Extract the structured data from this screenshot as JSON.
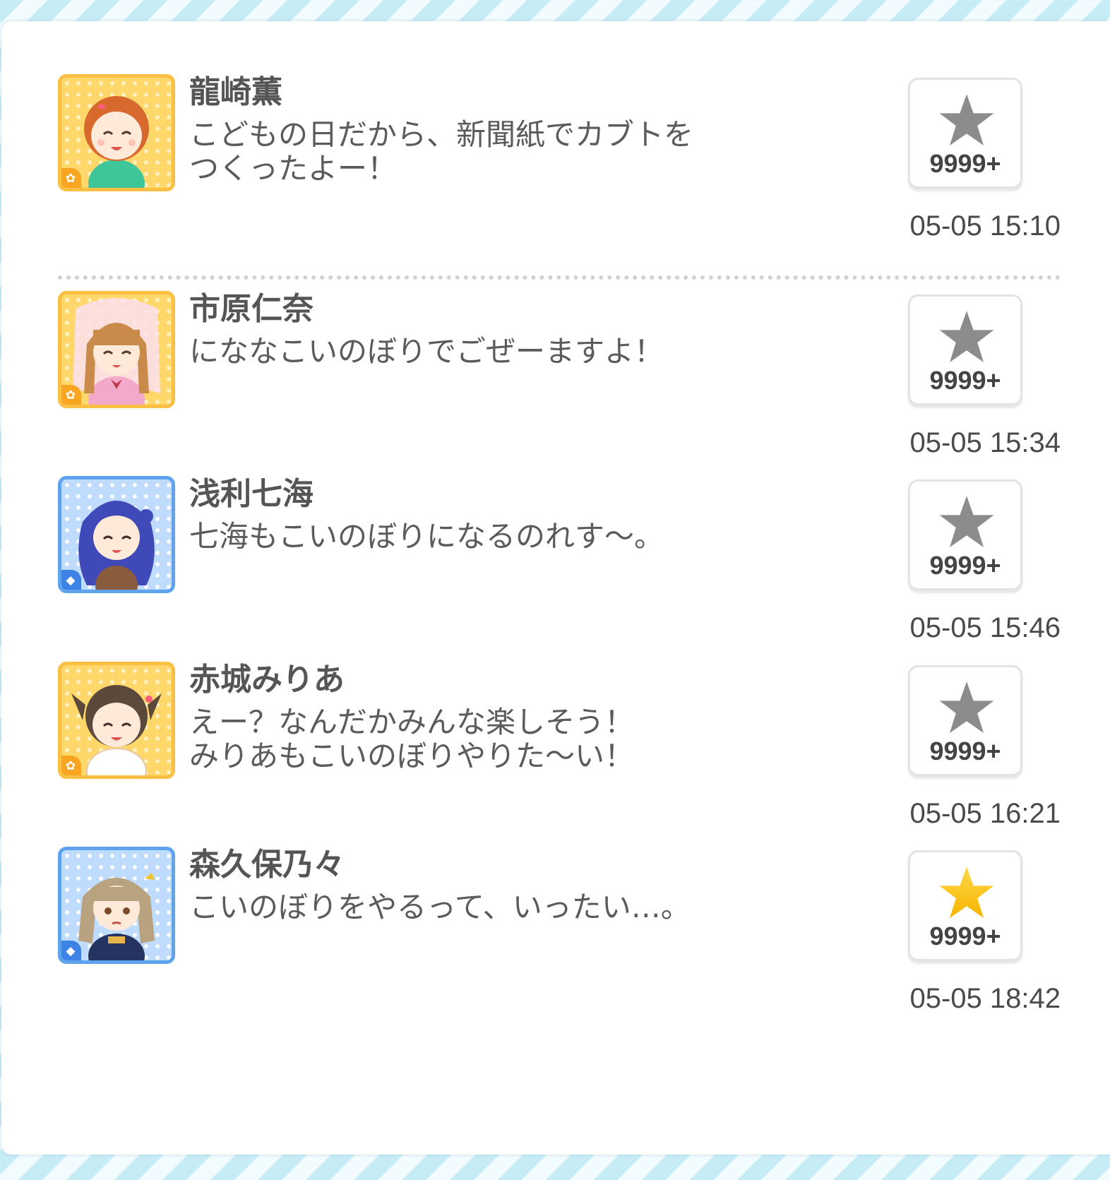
{
  "posts": [
    {
      "name": "龍崎薫",
      "message": "こどもの日だから、新聞紙でカブトを\nつくったよー！",
      "likes": "9999+",
      "time": "05-05 15:10",
      "liked": false,
      "attribute": "orange",
      "avatar": {
        "hair": "#d8692e",
        "outfit": "#3fc59a"
      }
    },
    {
      "name": "市原仁奈",
      "message": "にななこいのぼりでごぜーますよ！",
      "likes": "9999+",
      "time": "05-05 15:34",
      "liked": false,
      "attribute": "orange",
      "avatar": {
        "hair": "#c98a4a",
        "outfit": "#f3a9c9"
      }
    },
    {
      "name": "浅利七海",
      "message": "七海もこいのぼりになるのれす〜。",
      "likes": "9999+",
      "time": "05-05 15:46",
      "liked": false,
      "attribute": "blue",
      "avatar": {
        "hair": "#3f49b8",
        "outfit": "#8a5c3e"
      }
    },
    {
      "name": "赤城みりあ",
      "message": "えー？なんだかみんな楽しそう！\nみりあもこいのぼりやりた〜い！",
      "likes": "9999+",
      "time": "05-05 16:21",
      "liked": false,
      "attribute": "orange",
      "avatar": {
        "hair": "#5b4a3c",
        "outfit": "#ffffff"
      }
    },
    {
      "name": "森久保乃々",
      "message": "こいのぼりをやるって、いったい…。",
      "likes": "9999+",
      "time": "05-05 18:42",
      "liked": true,
      "attribute": "blue",
      "avatar": {
        "hair": "#b8a27f",
        "outfit": "#24335f"
      }
    }
  ],
  "icons": {
    "like": "star-icon",
    "cute_attribute": "flower-icon",
    "cool_attribute": "diamond-icon"
  },
  "colors": {
    "star_unliked": "#8c8c8c",
    "star_liked": "#ffc21a",
    "divider": "#d2d2d2",
    "cute_frame": "#fbbf44",
    "cool_frame": "#5fa3ef"
  }
}
